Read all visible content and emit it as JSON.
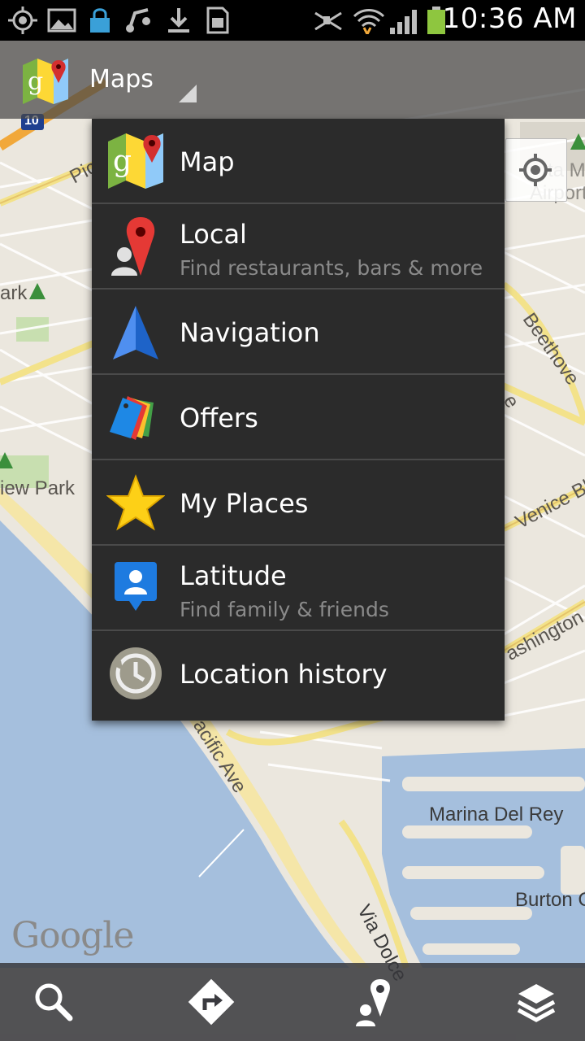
{
  "status_bar": {
    "time": "10:36 AM",
    "icons": [
      "gps-icon",
      "image-icon",
      "lock-icon",
      "music-icon",
      "download-icon",
      "sd-card-icon",
      "mute-icon",
      "wifi-icon",
      "signal-icon",
      "battery-icon"
    ]
  },
  "action_bar": {
    "app_title": "Maps",
    "logo": "google-maps-logo-icon"
  },
  "dropdown": {
    "items": [
      {
        "label": "Map",
        "subtitle": "",
        "icon": "map-icon"
      },
      {
        "label": "Local",
        "subtitle": "Find restaurants, bars & more",
        "icon": "local-pin-icon"
      },
      {
        "label": "Navigation",
        "subtitle": "",
        "icon": "navigation-arrow-icon"
      },
      {
        "label": "Offers",
        "subtitle": "",
        "icon": "offers-tag-icon"
      },
      {
        "label": "My Places",
        "subtitle": "",
        "icon": "star-icon"
      },
      {
        "label": "Latitude",
        "subtitle": "Find family & friends",
        "icon": "latitude-person-icon"
      },
      {
        "label": "Location history",
        "subtitle": "",
        "icon": "history-clock-icon"
      }
    ]
  },
  "map": {
    "labels": {
      "pico": "Pic",
      "ark": "ark",
      "view_park": "iew Park",
      "airport_1": "ta M",
      "airport_2": "Airport",
      "beethoven": "Beethove",
      "venice": "Venice Bl",
      "washington": "ashington",
      "pacific": "acific Ave",
      "marina": "Marina Del Rey",
      "burton": "Burton C",
      "via_dolce": "Via Dolce",
      "highway": "10",
      "e_letter": "e"
    },
    "attribution": "Google"
  },
  "bottom_bar": {
    "buttons": [
      "search-icon",
      "directions-icon",
      "places-pin-icon",
      "layers-icon"
    ]
  }
}
